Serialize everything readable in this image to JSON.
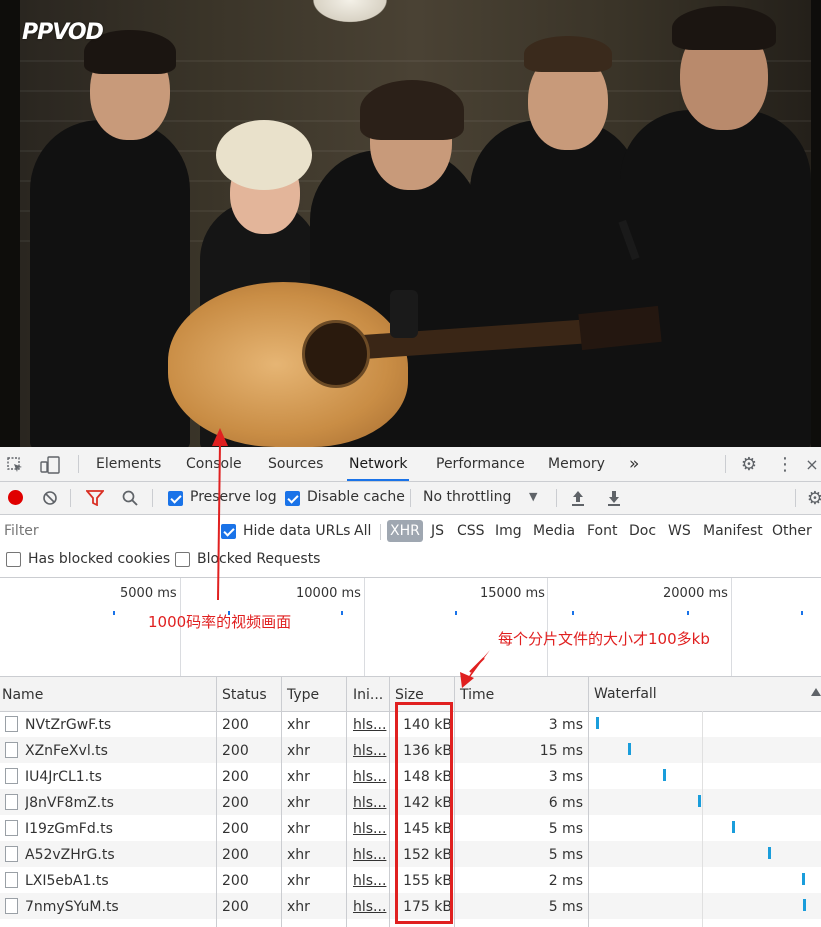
{
  "video": {
    "logo": "PPVOD"
  },
  "devtools": {
    "tabs": [
      "Elements",
      "Console",
      "Sources",
      "Network",
      "Performance",
      "Memory"
    ],
    "active_tab": "Network",
    "more_tabs_glyph": "»",
    "toolbar": {
      "preserve_log_label": "Preserve log",
      "preserve_log_checked": true,
      "disable_cache_label": "Disable cache",
      "disable_cache_checked": true,
      "throttling_value": "No throttling"
    },
    "filter": {
      "placeholder": "Filter",
      "hide_data_urls_label": "Hide data URLs",
      "hide_data_urls_checked": true,
      "types": [
        "All",
        "XHR",
        "JS",
        "CSS",
        "Img",
        "Media",
        "Font",
        "Doc",
        "WS",
        "Manifest",
        "Other"
      ],
      "selected_type": "XHR",
      "has_blocked_cookies_label": "Has blocked cookies",
      "blocked_requests_label": "Blocked Requests"
    },
    "overview": {
      "ticks": [
        "5000 ms",
        "10000 ms",
        "15000 ms",
        "20000 ms"
      ]
    },
    "table": {
      "columns": [
        "Name",
        "Status",
        "Type",
        "Ini...",
        "Size",
        "Time",
        "Waterfall"
      ],
      "rows": [
        {
          "name": "NVtZrGwF.ts",
          "status": "200",
          "type": "xhr",
          "initiator": "hls...",
          "size": "140 kB",
          "time": "3 ms"
        },
        {
          "name": "XZnFeXvl.ts",
          "status": "200",
          "type": "xhr",
          "initiator": "hls...",
          "size": "136 kB",
          "time": "15 ms"
        },
        {
          "name": "IU4JrCL1.ts",
          "status": "200",
          "type": "xhr",
          "initiator": "hls...",
          "size": "148 kB",
          "time": "3 ms"
        },
        {
          "name": "J8nVF8mZ.ts",
          "status": "200",
          "type": "xhr",
          "initiator": "hls...",
          "size": "142 kB",
          "time": "6 ms"
        },
        {
          "name": "I19zGmFd.ts",
          "status": "200",
          "type": "xhr",
          "initiator": "hls...",
          "size": "145 kB",
          "time": "5 ms"
        },
        {
          "name": "A52vZHrG.ts",
          "status": "200",
          "type": "xhr",
          "initiator": "hls...",
          "size": "152 kB",
          "time": "5 ms"
        },
        {
          "name": "LXI5ebA1.ts",
          "status": "200",
          "type": "xhr",
          "initiator": "hls...",
          "size": "155 kB",
          "time": "2 ms"
        },
        {
          "name": "7nmySYuM.ts",
          "status": "200",
          "type": "xhr",
          "initiator": "hls...",
          "size": "175 kB",
          "time": "5 ms"
        }
      ]
    }
  },
  "annotations": {
    "video_note": "1000码率的视频画面",
    "size_note": "每个分片文件的大小才100多kb",
    "color": "#e02020"
  },
  "colors": {
    "accent": "#1a73e8",
    "record": "#e00000",
    "filter_icon": "#d93025",
    "waterfall_bar": "#1a9ddb"
  }
}
